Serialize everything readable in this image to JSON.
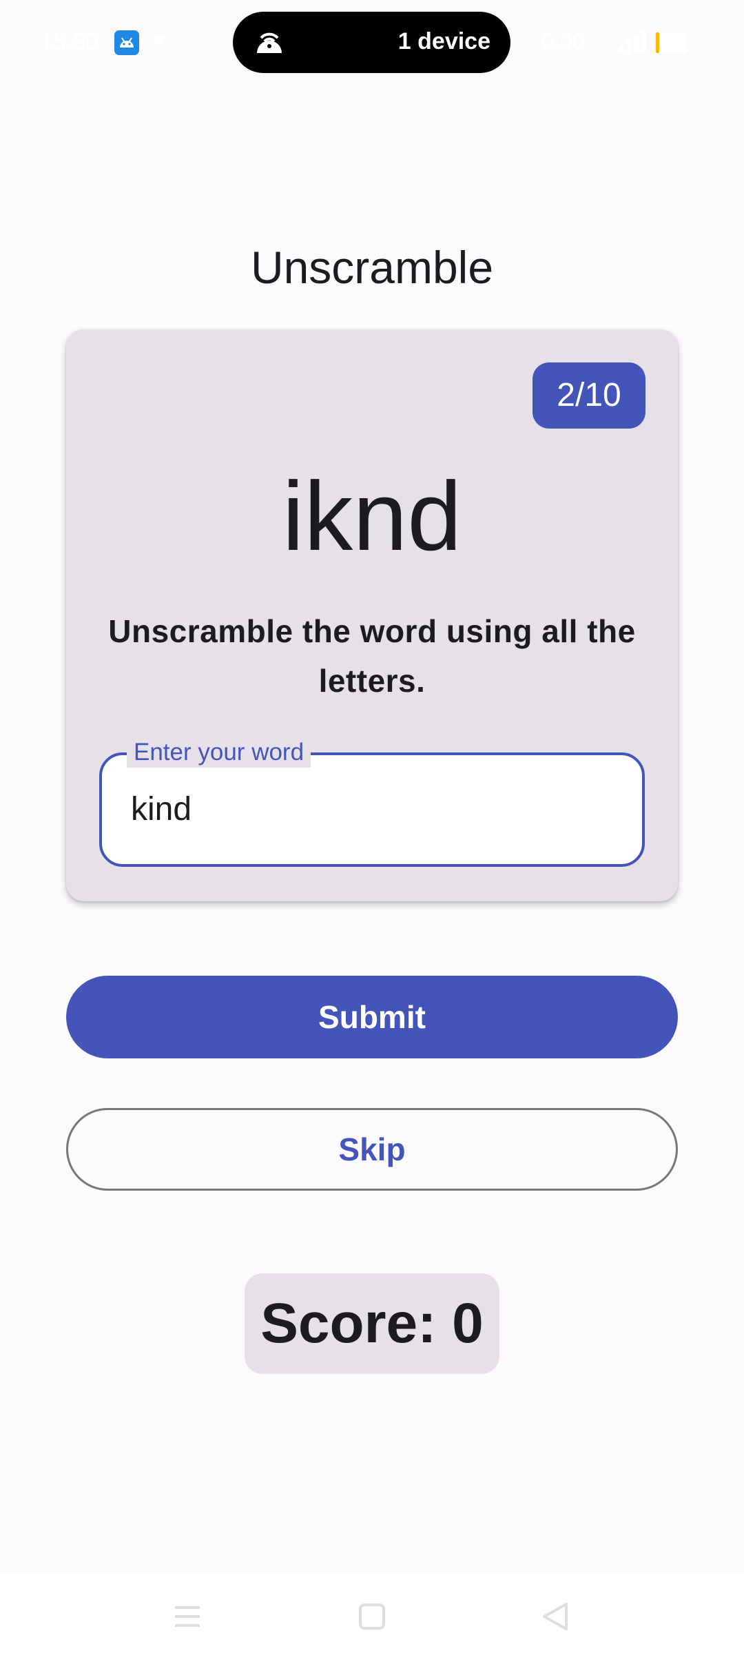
{
  "status_bar": {
    "time": "15:50",
    "device_pill_label": "1 device",
    "right_text": "0.00",
    "icons": [
      "android-icon",
      "hotspot-icon",
      "signal-icon",
      "battery-icon"
    ],
    "battery_color": "#f6b800"
  },
  "app": {
    "title": "Unscramble"
  },
  "card": {
    "word_count": "2/10",
    "scrambled_word": "iknd",
    "instructions": "Unscramble the word using all the letters.",
    "input": {
      "label": "Enter your word",
      "value": "kind"
    }
  },
  "actions": {
    "submit_label": "Submit",
    "skip_label": "Skip"
  },
  "score": {
    "text": "Score: 0"
  },
  "nav_bar": {
    "icons": [
      "menu-icon",
      "home-icon",
      "back-icon"
    ]
  },
  "colors": {
    "primary": "#4355b9",
    "surface_variant": "#e6e1e8",
    "background": "#fcfafd",
    "on_surface": "#1c1b1f",
    "outline": "#77767a"
  }
}
